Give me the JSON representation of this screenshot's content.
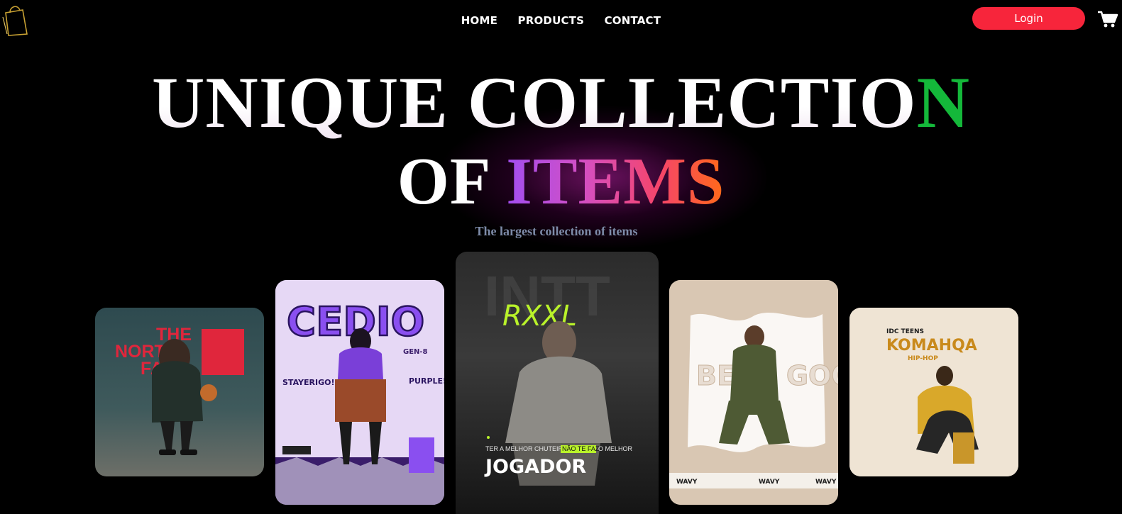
{
  "nav": {
    "items": [
      {
        "label": "HOME"
      },
      {
        "label": "PRODUCTS"
      },
      {
        "label": "CONTACT"
      }
    ],
    "login_label": "Login"
  },
  "hero": {
    "line1_main": "UNIQUE COLLECTIO",
    "line1_accent": "N",
    "line2_main": "OF ",
    "line2_gradient": "ITEMS",
    "subtitle": "The largest collection of items"
  },
  "colors": {
    "login_bg": "#f7253b",
    "accent_green": "#14b83a",
    "gradient": [
      "#a24ef0",
      "#d44fc4",
      "#f5456a",
      "#ff6a18"
    ],
    "subtitle": "#7d8ba8"
  },
  "icons": {
    "logo": "shopping-bag-logo-icon",
    "cart": "cart-icon"
  },
  "cards": [
    {
      "title_lines": [
        "THE",
        "NORTH",
        "FACE"
      ]
    },
    {
      "title": "CEDIO",
      "tag": "GEN-8",
      "left_text": "STAYERIGO!",
      "right_text": "PURPLE!"
    },
    {
      "title": "RXXL",
      "tagline_pre": "TER A MELHOR CHUTEIRA",
      "tagline_highlight": "NÃO TE FAZ",
      "tagline_post": "O MELHOR",
      "headline": "JOGADOR"
    },
    {
      "title": "BEAR GOOK",
      "footer_word": "WAVY"
    },
    {
      "header": "IDC TEENS",
      "title": "KOMAHQA",
      "genre": "HIP-HOP"
    }
  ]
}
